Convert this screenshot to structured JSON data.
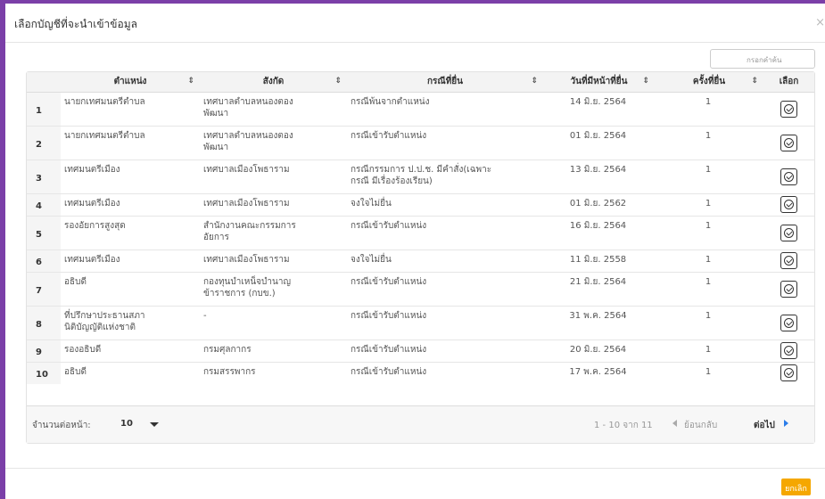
{
  "modal": {
    "title": "เลือกบัญชีที่จะนำเข้าข้อมูล",
    "close_icon": "close-icon"
  },
  "search": {
    "placeholder": "กรอกคำค้น"
  },
  "table": {
    "columns": [
      "",
      "ตำแหน่ง",
      "สังกัด",
      "กรณีที่ยื่น",
      "วันที่มีหน้าที่ยื่น",
      "ครั้งที่ยื่น",
      "เลือก"
    ],
    "sort_icon": "sort-icon",
    "rows": [
      {
        "num": "1",
        "position": "นายกเทศมนตรีตำบล",
        "agency": "เทศบาลตำบลหนองตอง\nพัฒนา",
        "case": "กรณีพ้นจากตำแหน่ง",
        "date": "14 มิ.ย. 2564",
        "count": "1"
      },
      {
        "num": "2",
        "position": "นายกเทศมนตรีตำบล",
        "agency": "เทศบาลตำบลหนองตอง\nพัฒนา",
        "case": "กรณีเข้ารับตำแหน่ง",
        "date": "01 มิ.ย. 2564",
        "count": "1"
      },
      {
        "num": "3",
        "position": "เทศมนตรีเมือง",
        "agency": "เทศบาลเมืองโพธาราม",
        "case": "กรณีกรรมการ ป.ป.ช. มีคำสั่ง(เฉพาะ\nกรณี มีเรื่องร้องเรียน)",
        "date": "13 มิ.ย. 2564",
        "count": "1"
      },
      {
        "num": "4",
        "position": "เทศมนตรีเมือง",
        "agency": "เทศบาลเมืองโพธาราม",
        "case": "จงใจไม่ยื่น",
        "date": "01 มิ.ย. 2562",
        "count": "1"
      },
      {
        "num": "5",
        "position": "รองอัยการสูงสุด",
        "agency": "สำนักงานคณะกรรมการ\nอัยการ",
        "case": "กรณีเข้ารับตำแหน่ง",
        "date": "16 มิ.ย. 2564",
        "count": "1"
      },
      {
        "num": "6",
        "position": "เทศมนตรีเมือง",
        "agency": "เทศบาลเมืองโพธาราม",
        "case": "จงใจไม่ยื่น",
        "date": "11 มิ.ย. 2558",
        "count": "1"
      },
      {
        "num": "7",
        "position": "อธิบดี",
        "agency": "กองทุนบำเหน็จบำนาญ\nข้าราชการ (กบข.)",
        "case": "กรณีเข้ารับตำแหน่ง",
        "date": "21 มิ.ย. 2564",
        "count": "1"
      },
      {
        "num": "8",
        "position": "ที่ปรึกษาประธานสภา\nนิติบัญญัติแห่งชาติ",
        "agency": "-",
        "case": "กรณีเข้ารับตำแหน่ง",
        "date": "31 พ.ค. 2564",
        "count": "1"
      },
      {
        "num": "9",
        "position": "รองอธิบดี",
        "agency": "กรมศุลกากร",
        "case": "กรณีเข้ารับตำแหน่ง",
        "date": "20 มิ.ย. 2564",
        "count": "1"
      },
      {
        "num": "10",
        "position": "อธิบดี",
        "agency": "กรมสรรพากร",
        "case": "กรณีเข้ารับตำแหน่ง",
        "date": "17 พ.ค. 2564",
        "count": "1"
      }
    ]
  },
  "pager": {
    "per_page_label": "จำนวนต่อหน้า:",
    "per_page_value": "10",
    "range": "1 - 10 จาก 11",
    "prev": "ย้อนกลับ",
    "next": "ต่อไป"
  },
  "footer": {
    "cancel": "ยกเลิก"
  },
  "colors": {
    "frame": "#7b3fa8",
    "cancel": "#f5a700",
    "next_arrow": "#2b7de9"
  }
}
